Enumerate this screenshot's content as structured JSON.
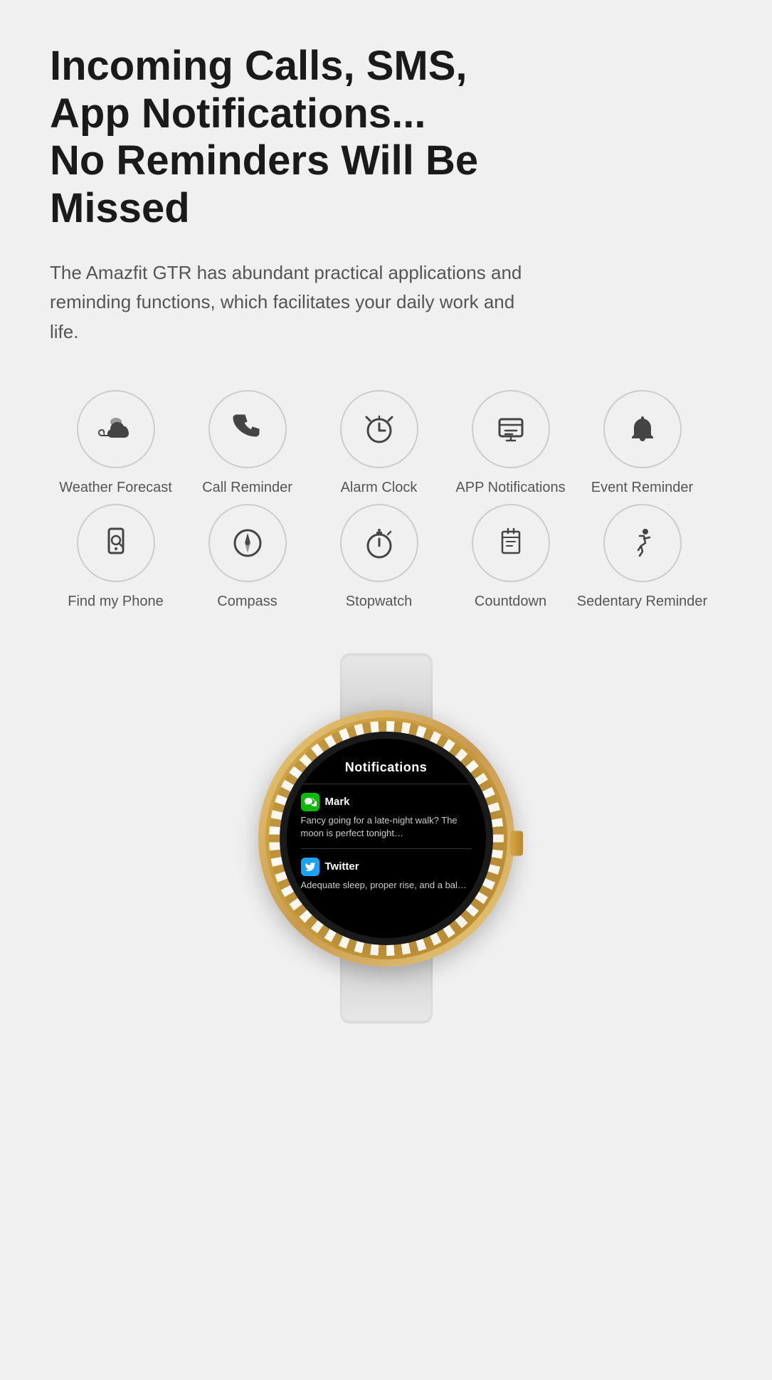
{
  "headline": {
    "line1": "Incoming Calls, SMS,",
    "line2": "App Notifications...",
    "line3": "No Reminders Will Be Missed"
  },
  "description": "The Amazfit GTR has abundant practical applications and reminding functions, which facilitates your daily work and life.",
  "icons_row1": [
    {
      "id": "weather-forecast",
      "label": "Weather Forecast",
      "icon": "cloud"
    },
    {
      "id": "call-reminder",
      "label": "Call Reminder",
      "icon": "phone"
    },
    {
      "id": "alarm-clock",
      "label": "Alarm Clock",
      "icon": "alarm"
    },
    {
      "id": "app-notifications",
      "label": "APP Notifications",
      "icon": "notification"
    },
    {
      "id": "event-reminder",
      "label": "Event Reminder",
      "icon": "bell"
    }
  ],
  "icons_row2": [
    {
      "id": "find-my-phone",
      "label": "Find my Phone",
      "icon": "findphone"
    },
    {
      "id": "compass",
      "label": "Compass",
      "icon": "compass"
    },
    {
      "id": "stopwatch",
      "label": "Stopwatch",
      "icon": "stopwatch"
    },
    {
      "id": "countdown",
      "label": "Countdown",
      "icon": "countdown"
    },
    {
      "id": "sedentary-reminder",
      "label": "Sedentary Reminder",
      "icon": "sedentary"
    }
  ],
  "watch": {
    "screen_title": "Notifications",
    "notifications": [
      {
        "app": "WeChat",
        "sender": "Mark",
        "message": "Fancy going for a late-night walk? The moon is perfect tonight…"
      },
      {
        "app": "Twitter",
        "sender": "Twitter",
        "message": "Adequate sleep, proper rise, and a bal…"
      }
    ]
  }
}
